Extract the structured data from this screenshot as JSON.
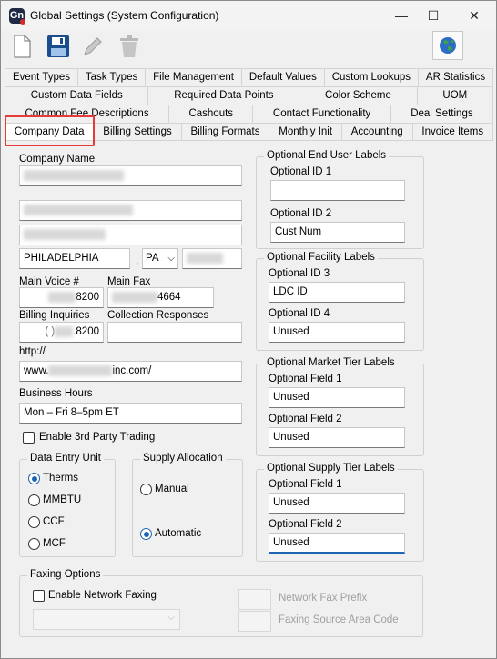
{
  "window": {
    "title": "Global Settings (System Configuration)",
    "app_icon_letter": "Gn",
    "minimize": "—",
    "maximize": "☐",
    "close": "✕"
  },
  "toolbar": {
    "new_icon": "new-document-icon",
    "save_icon": "save-icon",
    "edit_icon": "edit-pencil-icon",
    "delete_icon": "trash-icon",
    "globe_icon": "globe-icon"
  },
  "tabs": {
    "row1": [
      "Event Types",
      "Task Types",
      "File Management",
      "Default Values",
      "Custom Lookups",
      "AR Statistics"
    ],
    "row2": [
      "Custom Data Fields",
      "Required Data Points",
      "Color Scheme",
      "UOM"
    ],
    "row3": [
      "Common Fee Descriptions",
      "Cashouts",
      "Contact Functionality",
      "Deal Settings"
    ],
    "row4": [
      "Company Data",
      "Billing Settings",
      "Billing Formats",
      "Monthly Init",
      "Accounting",
      "Invoice Items"
    ],
    "active": "Company Data"
  },
  "company": {
    "name_label": "Company Name",
    "city": "PHILADELPHIA",
    "comma": ",",
    "state": "PA",
    "main_voice_label": "Main Voice #",
    "main_voice_suffix": "8200",
    "main_fax_label": "Main Fax",
    "main_fax_suffix": "4664",
    "billing_inquiries_label": "Billing Inquiries",
    "billing_inquiries_suffix": ".8200",
    "billing_inquiries_prefix": "(   )",
    "collection_responses_label": "Collection Responses",
    "http_label": "http://",
    "website_prefix": "www.",
    "website_suffix": "inc.com/",
    "business_hours_label": "Business Hours",
    "business_hours_value": "Mon – Fri 8–5pm ET",
    "third_party_label": "Enable 3rd Party Trading"
  },
  "data_entry_unit": {
    "title": "Data Entry Unit",
    "options": [
      "Therms",
      "MMBTU",
      "CCF",
      "MCF"
    ],
    "selected": "Therms"
  },
  "supply_allocation": {
    "title": "Supply Allocation",
    "options": [
      "Manual",
      "Automatic"
    ],
    "selected": "Automatic"
  },
  "end_user_labels": {
    "title": "Optional End User Labels",
    "id1_label": "Optional ID 1",
    "id1_value": "",
    "id2_label": "Optional ID 2",
    "id2_value": "Cust Num"
  },
  "facility_labels": {
    "title": "Optional Facility Labels",
    "id3_label": "Optional ID 3",
    "id3_value": "LDC ID",
    "id4_label": "Optional ID 4",
    "id4_value": "Unused"
  },
  "market_tier_labels": {
    "title": "Optional Market Tier Labels",
    "f1_label": "Optional Field 1",
    "f1_value": "Unused",
    "f2_label": "Optional Field 2",
    "f2_value": "Unused"
  },
  "supply_tier_labels": {
    "title": "Optional Supply Tier Labels",
    "f1_label": "Optional Field 1",
    "f1_value": "Unused",
    "f2_label": "Optional Field 2",
    "f2_value": "Unused"
  },
  "faxing": {
    "title": "Faxing Options",
    "enable_label": "Enable Network Faxing",
    "prefix_label": "Network Fax Prefix",
    "area_code_label": "Faxing Source Area Code"
  },
  "colors": {
    "accent": "#1f63b4",
    "highlight": "#e63b3b",
    "save_icon": "#1b4d8c"
  }
}
